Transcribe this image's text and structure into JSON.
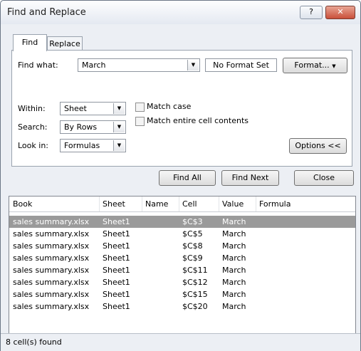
{
  "window": {
    "title": "Find and Replace",
    "help_label": "?",
    "close_label": "✕"
  },
  "tabs": [
    {
      "label": "Find",
      "active": true
    },
    {
      "label": "Replace",
      "active": false
    }
  ],
  "find": {
    "find_what_label": "Find what:",
    "find_what_value": "March",
    "no_format_label": "No Format Set",
    "format_button": "Format...",
    "within_label": "Within:",
    "within_value": "Sheet",
    "search_label": "Search:",
    "search_value": "By Rows",
    "look_in_label": "Look in:",
    "look_in_value": "Formulas",
    "match_case_label": "Match case",
    "match_entire_label": "Match entire cell contents",
    "options_button": "Options <<"
  },
  "actions": {
    "find_all": "Find All",
    "find_next": "Find Next",
    "close": "Close"
  },
  "results": {
    "columns": [
      "Book",
      "Sheet",
      "Name",
      "Cell",
      "Value",
      "Formula"
    ],
    "rows": [
      {
        "book": "sales summary.xlsx",
        "sheet": "Sheet1",
        "name": "",
        "cell": "$C$3",
        "value": "March",
        "formula": ""
      },
      {
        "book": "sales summary.xlsx",
        "sheet": "Sheet1",
        "name": "",
        "cell": "$C$5",
        "value": "March",
        "formula": ""
      },
      {
        "book": "sales summary.xlsx",
        "sheet": "Sheet1",
        "name": "",
        "cell": "$C$8",
        "value": "March",
        "formula": ""
      },
      {
        "book": "sales summary.xlsx",
        "sheet": "Sheet1",
        "name": "",
        "cell": "$C$9",
        "value": "March",
        "formula": ""
      },
      {
        "book": "sales summary.xlsx",
        "sheet": "Sheet1",
        "name": "",
        "cell": "$C$11",
        "value": "March",
        "formula": ""
      },
      {
        "book": "sales summary.xlsx",
        "sheet": "Sheet1",
        "name": "",
        "cell": "$C$12",
        "value": "March",
        "formula": ""
      },
      {
        "book": "sales summary.xlsx",
        "sheet": "Sheet1",
        "name": "",
        "cell": "$C$15",
        "value": "March",
        "formula": ""
      },
      {
        "book": "sales summary.xlsx",
        "sheet": "Sheet1",
        "name": "",
        "cell": "$C$20",
        "value": "March",
        "formula": ""
      }
    ]
  },
  "status": {
    "text": "8 cell(s) found"
  },
  "colors": {
    "selected_row": "#9a9a9a",
    "title_bar": "#e4e9f1",
    "close_button": "#c9503a"
  }
}
